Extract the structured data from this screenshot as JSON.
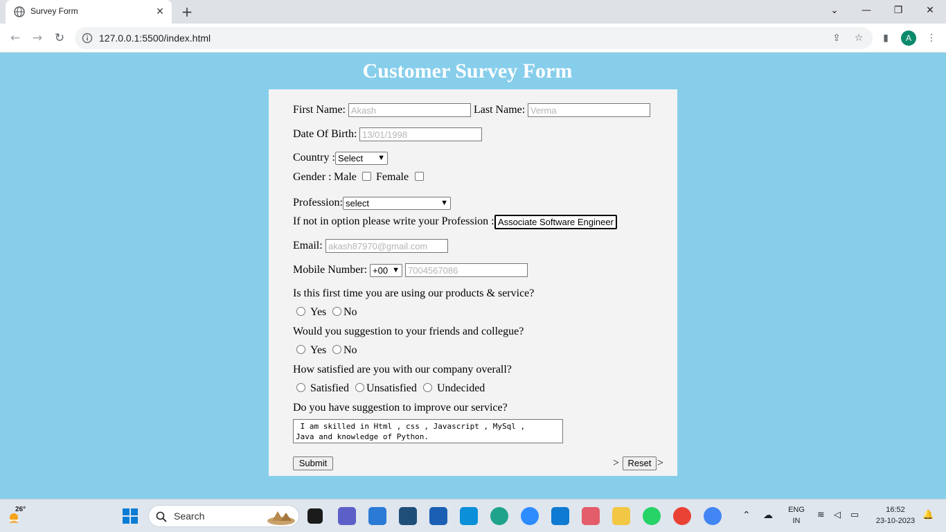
{
  "browser": {
    "tab_title": "Survey Form",
    "url": "127.0.0.1:5500/index.html",
    "profile_initial": "A",
    "minimize": "—",
    "restore": "❐",
    "close": "✕",
    "tab_list": "⌄"
  },
  "page": {
    "title": "Customer Survey Form"
  },
  "form": {
    "first_name_label": "First Name:",
    "first_name_placeholder": "Akash",
    "last_name_label": "Last Name:",
    "last_name_placeholder": "Verma",
    "dob_label": "Date Of Birth:",
    "dob_placeholder": "13/01/1998",
    "country_label": "Country :",
    "country_value": "Select",
    "gender_label": "Gender :",
    "gender_male": "Male",
    "gender_female": "Female",
    "profession_label": "Profession:",
    "profession_value": "select",
    "profession_other_label": "If not in option please write your Profession :",
    "profession_other_value": "Associate Software Engineer",
    "email_label": "Email:",
    "email_placeholder": "akash87970@gmail.com",
    "mobile_label": "Mobile Number:",
    "mobile_code": "+00",
    "mobile_placeholder": "7004567086",
    "q1": "Is this first time you are using our products & service?",
    "q2": "Would you suggestion to your friends and collegue?",
    "q3": "How satisfied are you with our company overall?",
    "q4": "Do you have suggestion to improve our service?",
    "yes": "Yes",
    "no": "No",
    "satisfied": "Satisfied",
    "unsatisfied": "Unsatisfied",
    "undecided": "Undecided",
    "suggestion_text": " I am skilled in Html , css , Javascript , MySql ,\nJava and knowledge of Python.",
    "submit": "Submit",
    "reset": "Reset",
    "reset_prefix": ">",
    "reset_suffix": ">"
  },
  "taskbar": {
    "weather_temp": "26°",
    "search_label": "Search",
    "lang_top": "ENG",
    "lang_bottom": "IN",
    "time": "16:52",
    "date": "23-10-2023"
  },
  "colors": {
    "page_background": "#87ceeb",
    "card_background": "#f3f3f3"
  }
}
